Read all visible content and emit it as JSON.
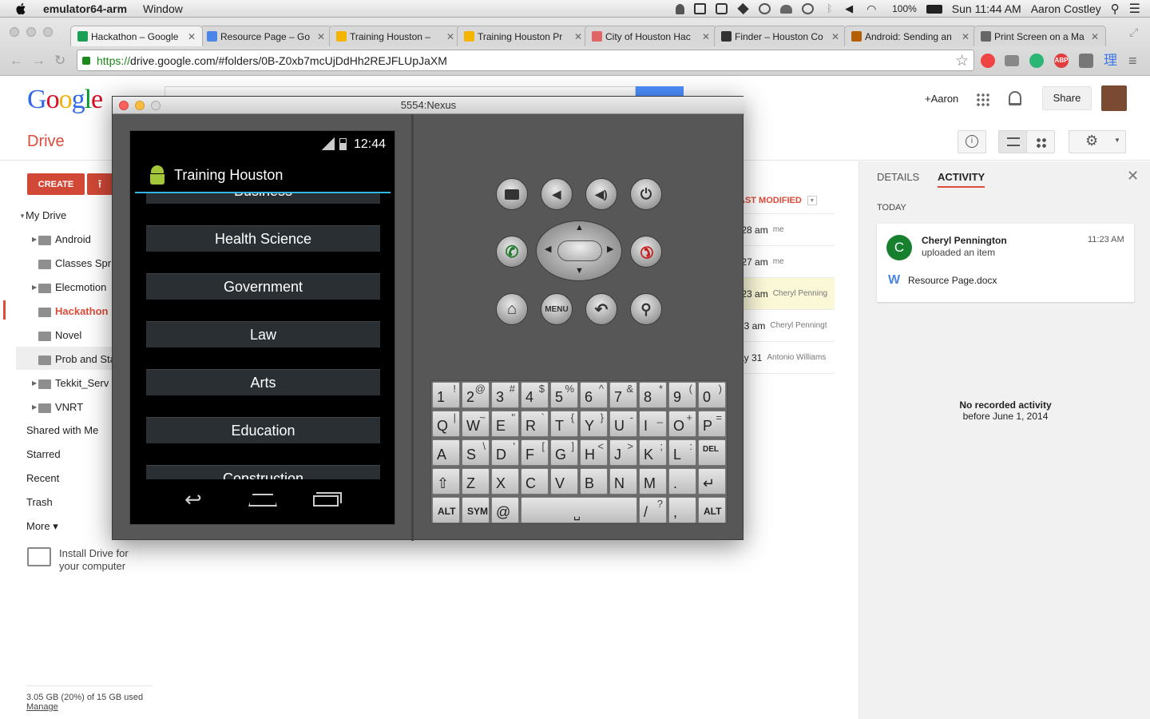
{
  "menubar": {
    "app_name": "emulator64-arm",
    "menus": [
      "Window"
    ],
    "battery": "100%",
    "clock": "Sun 11:44 AM",
    "user": "Aaron Costley"
  },
  "browser": {
    "tabs": [
      {
        "title": "Hackathon – Google",
        "color": "#1a9f55",
        "active": true
      },
      {
        "title": "Resource Page – Go",
        "color": "#4a86e8",
        "active": false
      },
      {
        "title": "Training Houston –",
        "color": "#f4b400",
        "active": false
      },
      {
        "title": "Training Houston Pr",
        "color": "#f4b400",
        "active": false
      },
      {
        "title": "City of Houston Hac",
        "color": "#e06666",
        "active": false
      },
      {
        "title": "Finder – Houston Co",
        "color": "#333333",
        "active": false
      },
      {
        "title": "Android: Sending an",
        "color": "#b45f06",
        "active": false
      },
      {
        "title": "Print Screen on a Ma",
        "color": "#666666",
        "active": false
      }
    ],
    "url_scheme": "https://",
    "url_rest": "drive.google.com/#folders/0B-Z0xb7mcUjDdHh2REJFLUpJaXM"
  },
  "drive": {
    "logo": "Google",
    "plus_user": "+Aaron",
    "share_label": "Share",
    "title": "Drive",
    "create_label": "CREATE",
    "nav": {
      "my_drive": "My Drive",
      "folders": [
        "Android",
        "Classes Spr",
        "Elecmotion",
        "Hackathon",
        "Novel",
        "Prob and Sta",
        "Tekkit_Serv",
        "VNRT"
      ],
      "shared": "Shared with Me",
      "starred": "Starred",
      "recent": "Recent",
      "trash": "Trash",
      "more": "More ▾",
      "install_line1": "Install Drive for",
      "install_line2": "your computer"
    },
    "storage": "3.05 GB (20%) of 15 GB used",
    "manage": "Manage",
    "sort_header": "AST MODIFIED",
    "rows": [
      {
        "time": ":28 am",
        "owner": "me"
      },
      {
        "time": ":27 am",
        "owner": "me"
      },
      {
        "time": ":23 am",
        "owner": "Cheryl Penning"
      },
      {
        "time": "53 am",
        "owner": "Cheryl Penningt"
      },
      {
        "time": "ay 31",
        "owner": "Antonio Williams"
      }
    ],
    "panel": {
      "tab_details": "DETAILS",
      "tab_activity": "ACTIVITY",
      "today": "TODAY",
      "avatar_letter": "C",
      "actor": "Cheryl Pennington",
      "action": "uploaded an item",
      "time": "11:23 AM",
      "file": "Resource Page.docx",
      "no_activity_1": "No recorded activity",
      "no_activity_2": "before June 1, 2014"
    }
  },
  "emulator": {
    "window_title": "5554:Nexus",
    "status_time": "12:44",
    "app_title": "Training Houston",
    "partial_top": "Business",
    "categories": [
      "Health Science",
      "Government",
      "Law",
      "Arts",
      "Education"
    ],
    "partial_bottom": "Construction",
    "menu_label": "MENU",
    "keys_row1": [
      [
        "1",
        "!"
      ],
      [
        "2",
        "@"
      ],
      [
        "3",
        "#"
      ],
      [
        "4",
        "$"
      ],
      [
        "5",
        "%"
      ],
      [
        "6",
        "^"
      ],
      [
        "7",
        "&"
      ],
      [
        "8",
        "*"
      ],
      [
        "9",
        "("
      ],
      [
        "0",
        ")"
      ]
    ],
    "keys_row2": [
      [
        "Q",
        "|"
      ],
      [
        "W",
        "~"
      ],
      [
        "E",
        "\""
      ],
      [
        "R",
        "`"
      ],
      [
        "T",
        "{"
      ],
      [
        "Y",
        "}"
      ],
      [
        "U",
        "-"
      ],
      [
        "I",
        "_"
      ],
      [
        "O",
        "+"
      ],
      [
        "P",
        "="
      ]
    ],
    "keys_row3": [
      [
        "A",
        ""
      ],
      [
        "S",
        "\\"
      ],
      [
        "D",
        "'"
      ],
      [
        "F",
        "["
      ],
      [
        "G",
        "]"
      ],
      [
        "H",
        "<"
      ],
      [
        "J",
        ">"
      ],
      [
        "K",
        ";"
      ],
      [
        "L",
        ":"
      ],
      [
        "DEL",
        ""
      ]
    ],
    "keys_row4": [
      [
        "⇧",
        ""
      ],
      [
        "Z",
        ""
      ],
      [
        "X",
        ""
      ],
      [
        "C",
        ""
      ],
      [
        "V",
        ""
      ],
      [
        "B",
        ""
      ],
      [
        "N",
        ""
      ],
      [
        "M",
        ""
      ],
      [
        ".",
        ""
      ],
      [
        "↵",
        ""
      ]
    ],
    "keys_row5": [
      [
        "ALT",
        ""
      ],
      [
        "SYM",
        ""
      ],
      [
        "@",
        ""
      ],
      [
        "␣",
        ""
      ],
      [
        "/",
        "?"
      ],
      [
        ",",
        ""
      ],
      [
        "ALT",
        ""
      ]
    ]
  }
}
